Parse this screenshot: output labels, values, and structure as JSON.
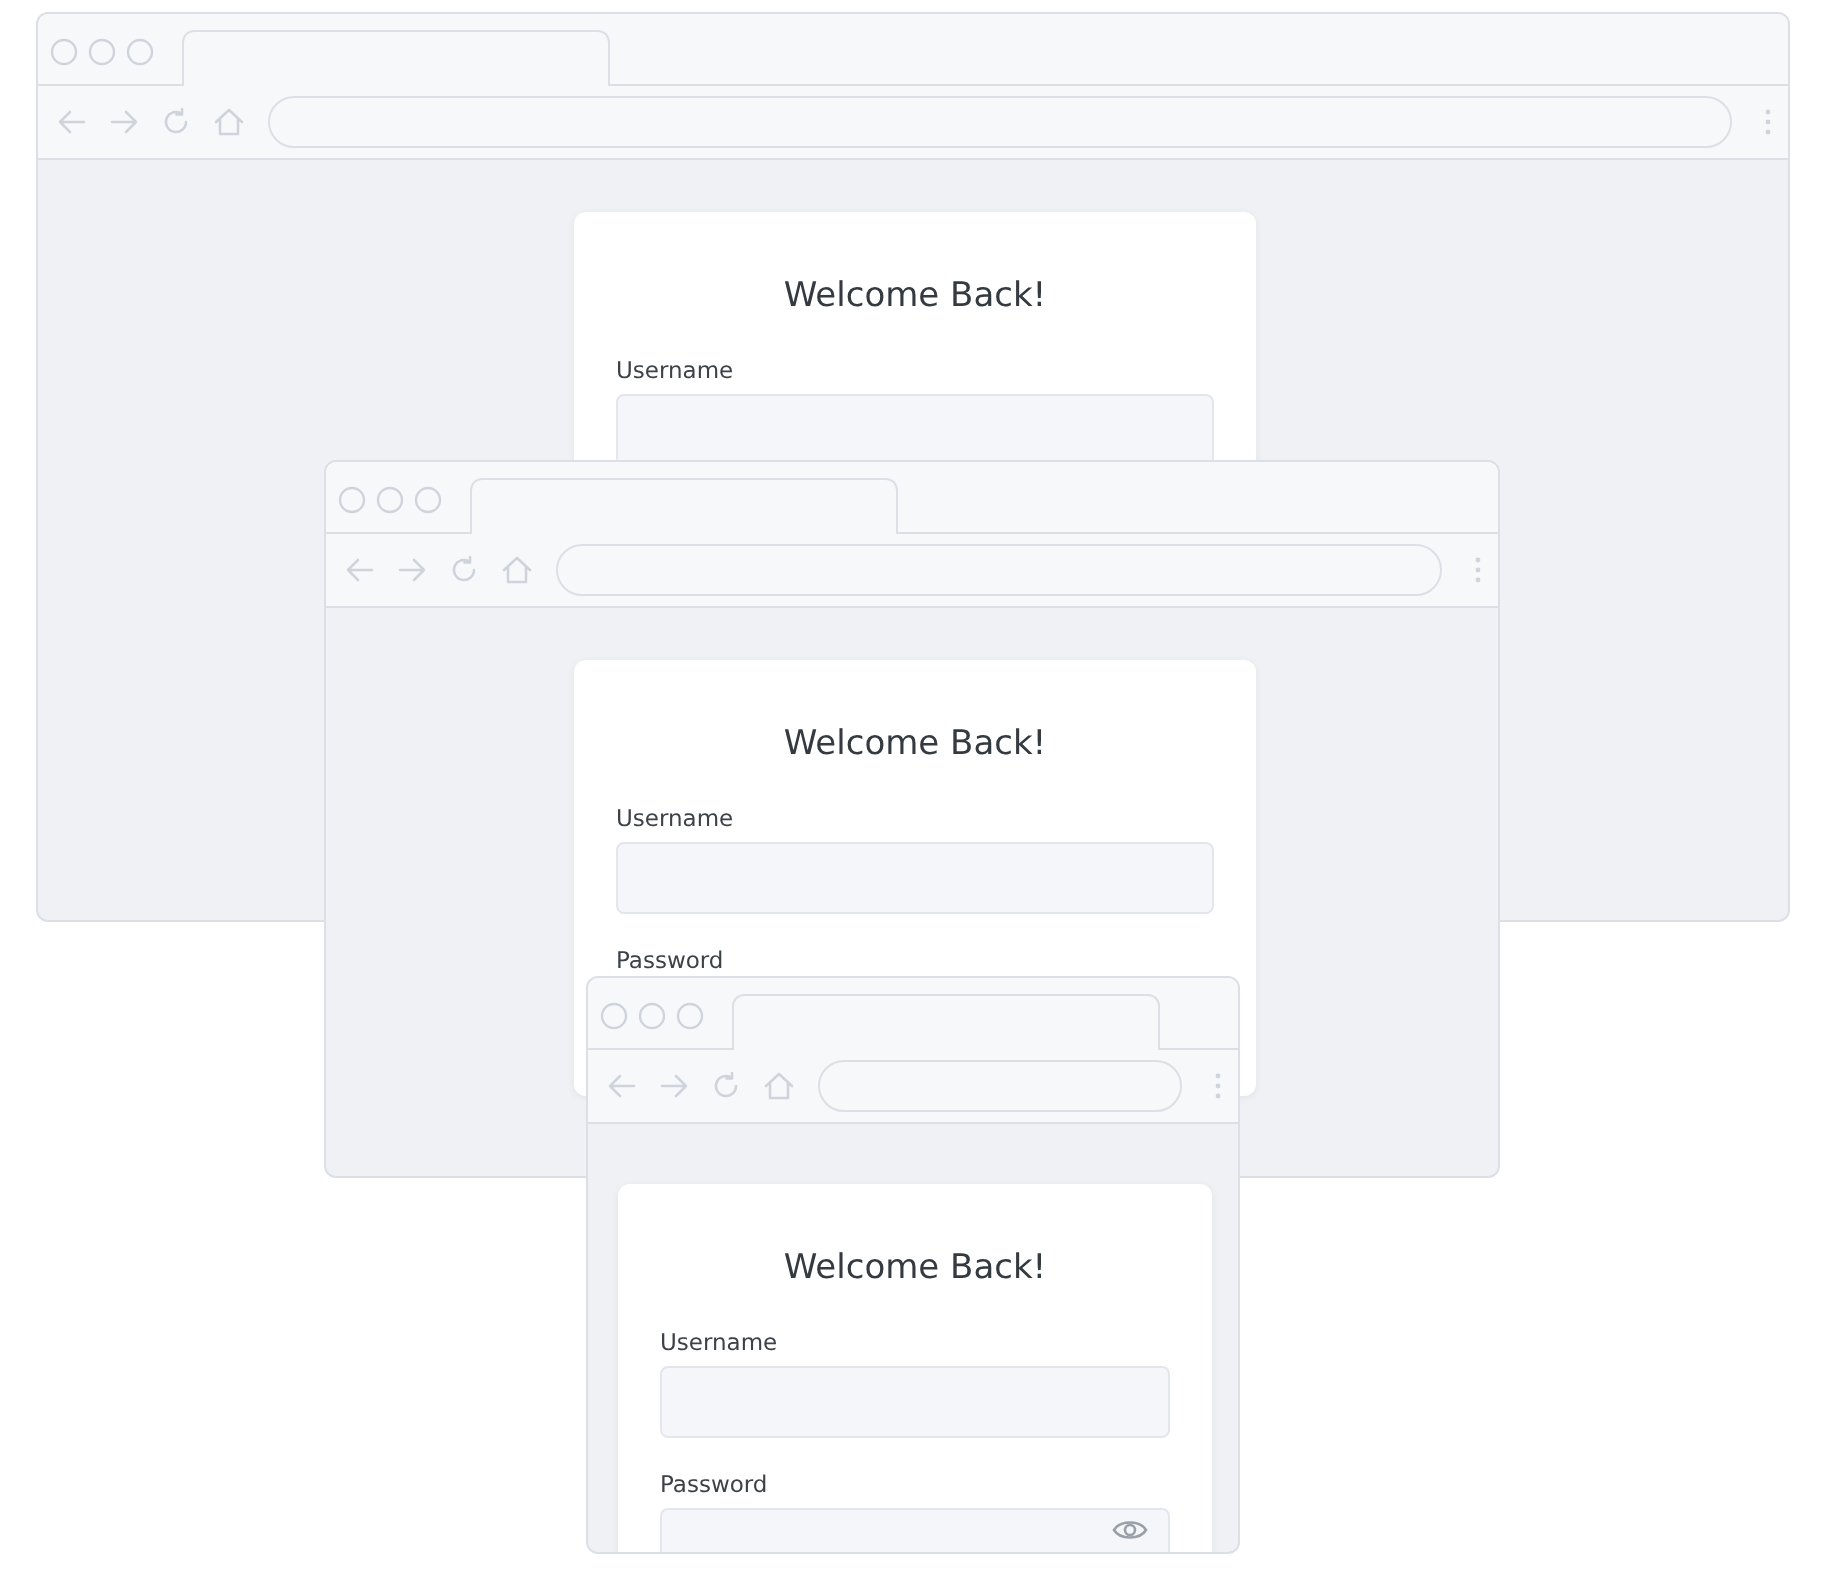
{
  "windows": [
    {
      "card": {
        "title": "Welcome Back!",
        "fields": [
          {
            "label": "Username",
            "kind": "text"
          }
        ]
      }
    },
    {
      "card": {
        "title": "Welcome Back!",
        "fields": [
          {
            "label": "Username",
            "kind": "text"
          },
          {
            "label": "Password",
            "kind": "label"
          }
        ]
      }
    },
    {
      "card": {
        "title": "Welcome Back!",
        "fields": [
          {
            "label": "Username",
            "kind": "text"
          },
          {
            "label": "Password",
            "kind": "password"
          }
        ]
      }
    }
  ]
}
